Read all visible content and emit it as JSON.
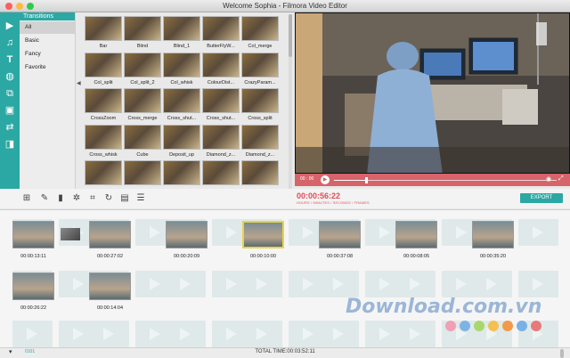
{
  "window": {
    "title": "Welcome Sophia - Filmora Video Editor",
    "controls": {
      "close": "#fc605c",
      "minimize": "#fdbc40",
      "zoom": "#34c84a"
    }
  },
  "colors": {
    "accent": "#2ba8a3",
    "timecode": "#e24a57",
    "progress": "#d5646b",
    "selected_clip": "#e8d34a"
  },
  "sidebar_icons": [
    "film-icon",
    "music-icon",
    "text-icon",
    "filter-icon",
    "overlay-icon",
    "image-icon",
    "transition-icon",
    "split-screen-icon"
  ],
  "categories": {
    "header": "Transitions",
    "items": [
      "All",
      "Basic",
      "Fancy",
      "Favorite"
    ],
    "selected": "All"
  },
  "transitions": [
    "Bar",
    "Blind",
    "Blind_1",
    "ButterFlyW...",
    "Col_merge",
    "Col_split",
    "Col_split_2",
    "Col_whisk",
    "ColourDist...",
    "CrazyParam...",
    "CrossZoom",
    "Cross_merge",
    "Cross_shut...",
    "Cross_shut...",
    "Cross_split",
    "Cross_whisk",
    "Cube",
    "Deposit_up",
    "Diamond_z...",
    "Diamond_z...",
    "",
    "",
    "",
    "",
    ""
  ],
  "preview": {
    "timecode_left": "00 : 00",
    "progress": 0.14
  },
  "toolbar_icons": [
    "add-media-icon",
    "edit-icon",
    "delete-icon",
    "color-icon",
    "crop-icon",
    "rotate-icon",
    "screenshot-icon",
    "adjust-icon"
  ],
  "timecode": {
    "value": "00:00:56:22",
    "caption": "HOURS / MINUTES / SECONDS / FRAMES"
  },
  "export_label": "EXPORT",
  "clips": [
    {
      "label": "00:00:13:11"
    },
    {
      "label": "00:00:27:02"
    },
    {
      "label": "00:00:20:09"
    },
    {
      "label": "00:00:10:00",
      "selected": true
    },
    {
      "label": "00:00:37:08"
    },
    {
      "label": "00:00:08:05"
    },
    {
      "label": "00:00:35:20"
    },
    {
      "label": "00:00:26:22"
    },
    {
      "label": "00:00:14:04"
    }
  ],
  "watermark": "Download.com.vn",
  "watermark_dots": [
    "#f0a0b4",
    "#7fb3e6",
    "#a8d86b",
    "#f5c04f",
    "#f29a4a",
    "#7ab0e6",
    "#e87a7a"
  ],
  "status": {
    "total_time": "TOTAL TIME:00:03:52:11",
    "timeline_toggle": "0101"
  }
}
